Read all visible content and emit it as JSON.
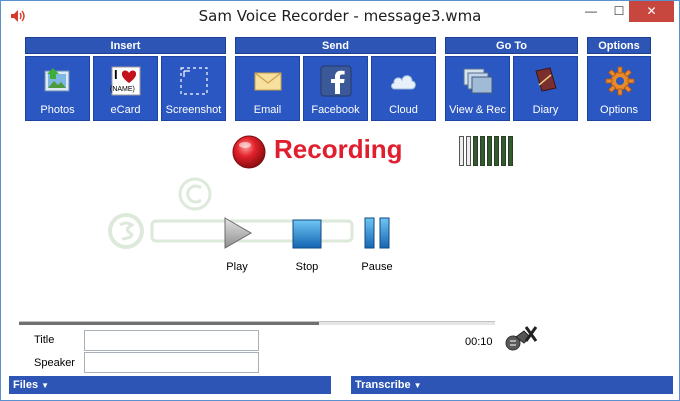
{
  "window": {
    "title": "Sam Voice Recorder - message3.wma",
    "minimize_glyph": "—",
    "maximize_glyph": "☐",
    "close_glyph": "✕"
  },
  "toolbar": {
    "groups": [
      {
        "header": "Insert",
        "buttons": [
          {
            "label": "Photos",
            "icon": "photos-icon"
          },
          {
            "label": "eCard",
            "icon": "ecard-icon"
          },
          {
            "label": "Screenshot",
            "icon": "screenshot-icon"
          }
        ]
      },
      {
        "header": "Send",
        "buttons": [
          {
            "label": "Email",
            "icon": "email-icon"
          },
          {
            "label": "Facebook",
            "icon": "facebook-icon"
          },
          {
            "label": "Cloud",
            "icon": "cloud-icon"
          }
        ]
      },
      {
        "header": "Go To",
        "buttons": [
          {
            "label": "View & Rec",
            "icon": "view-rec-icon"
          },
          {
            "label": "Diary",
            "icon": "diary-icon"
          }
        ]
      },
      {
        "header": "Options",
        "buttons": [
          {
            "label": "Options",
            "icon": "gear-icon"
          }
        ]
      }
    ],
    "ecard_icon_text": "(NAME)",
    "ecard_icon_letter": "I"
  },
  "status": {
    "recording_text": "Recording",
    "level_bars_total": 8,
    "level_bars_active": 6
  },
  "transport": {
    "play_label": "Play",
    "stop_label": "Stop",
    "pause_label": "Pause"
  },
  "progress": {
    "fraction": 0.63
  },
  "fields": {
    "title_label": "Title",
    "title_value": "",
    "speaker_label": "Speaker",
    "speaker_value": ""
  },
  "time_readout": "00:10",
  "bottom": {
    "files_label": "Files",
    "transcribe_label": "Transcribe"
  },
  "colors": {
    "accent": "#2b57c2",
    "recording_red": "#e01e2e",
    "close_button": "#c7463d"
  }
}
